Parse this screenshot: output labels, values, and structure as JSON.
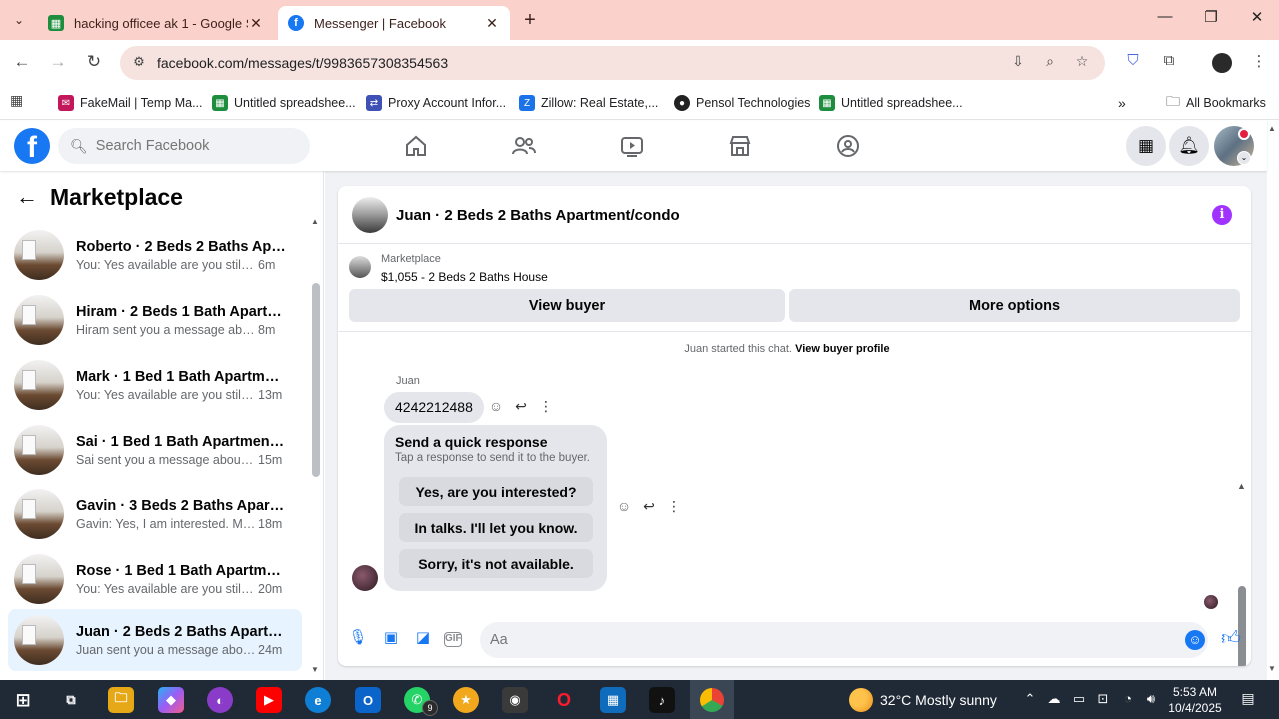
{
  "browser": {
    "tabs": [
      {
        "title": "hacking officee ak 1 - Google Sh",
        "favicon": "sheets-icon",
        "active": false
      },
      {
        "title": "Messenger | Facebook",
        "favicon": "facebook-icon",
        "active": true
      }
    ],
    "url": "facebook.com/messages/t/9983657308354563",
    "bookmarks": [
      {
        "label": "FakeMail | Temp Ma...",
        "icon": "fakemail-icon",
        "color": "#c2185b"
      },
      {
        "label": "Untitled spreadshee...",
        "icon": "sheets-icon",
        "color": "#1e8e3e"
      },
      {
        "label": "Proxy Account Infor...",
        "icon": "proxy-icon",
        "color": "#3f51b5"
      },
      {
        "label": "Zillow: Real Estate,...",
        "icon": "zillow-icon",
        "color": "#1a73e8"
      },
      {
        "label": "Pensol Technologies",
        "icon": "pensol-icon",
        "color": "#222222"
      },
      {
        "label": "Untitled spreadshee...",
        "icon": "sheets-icon",
        "color": "#1e8e3e"
      }
    ],
    "all_bookmarks": "All Bookmarks"
  },
  "facebook": {
    "search_placeholder": "Search Facebook",
    "brand_color": "#1877f2"
  },
  "left_panel": {
    "title": "Marketplace",
    "conversations": [
      {
        "name": "Roberto · 2 Beds 2 Baths Apart...",
        "snippet": "You: Yes available are you still inter...",
        "time": "6m",
        "selected": false
      },
      {
        "name": "Hiram · 2 Beds 1 Bath Apartmen...",
        "snippet": "Hiram sent you a message about y...",
        "time": "8m",
        "selected": false
      },
      {
        "name": "Mark · 1 Bed 1 Bath Apartment/...",
        "snippet": "You: Yes available are you still int...",
        "time": "13m",
        "selected": false
      },
      {
        "name": "Sai · 1 Bed 1 Bath Apartment/co...",
        "snippet": "Sai sent you a message about yo...",
        "time": "15m",
        "selected": false
      },
      {
        "name": "Gavin · 3 Beds 2 Baths Apartme...",
        "snippet": "Gavin: Yes, I am interested. My n...",
        "time": "18m",
        "selected": false
      },
      {
        "name": "Rose · 1 Bed 1 Bath Apartment/c...",
        "snippet": "You: Yes available are you still int...",
        "time": "20m",
        "selected": false
      },
      {
        "name": "Juan · 2 Beds 2 Baths Apartmen...",
        "snippet": "Juan sent you a message about y...",
        "time": "24m",
        "selected": true
      }
    ]
  },
  "chat": {
    "title": "Juan · 2 Beds 2 Baths Apartment/condo",
    "listing_tag": "Marketplace",
    "listing_title": "$1,055 - 2 Beds 2 Baths House",
    "view_buyer": "View buyer",
    "more_options": "More options",
    "started_text": "Juan started this chat.",
    "view_profile": "View buyer profile",
    "sender": "Juan",
    "message": "4242212488",
    "quick_title": "Send a quick response",
    "quick_subtitle": "Tap a response to send it to the buyer.",
    "quick_responses": [
      "Yes, are you interested?",
      "In talks. I'll let you know.",
      "Sorry, it's not available."
    ],
    "composer_placeholder": "Aa"
  },
  "taskbar": {
    "weather": "32°C  Mostly sunny",
    "time": "5:53 AM",
    "date": "10/4/2025",
    "whatsapp_badge": "9"
  }
}
